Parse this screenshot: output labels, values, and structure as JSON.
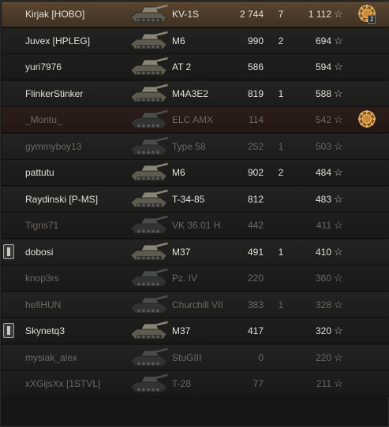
{
  "rows": [
    {
      "name": "Kirjak [HOBO]",
      "vehicle": "KV-1S",
      "damage": "2 744",
      "kills": "7",
      "xp": "1 112",
      "alive": true,
      "me": true,
      "platoon": false,
      "medal": true,
      "medal_count": "2"
    },
    {
      "name": "Juvex [HPLEG]",
      "vehicle": "M6",
      "damage": "990",
      "kills": "2",
      "xp": "694",
      "alive": true,
      "platoon": false,
      "medal": false
    },
    {
      "name": "yuri7976",
      "vehicle": "AT 2",
      "damage": "586",
      "kills": "",
      "xp": "594",
      "alive": true,
      "platoon": false,
      "medal": false
    },
    {
      "name": "FlinkerStinker",
      "vehicle": "M4A3E2",
      "damage": "819",
      "kills": "1",
      "xp": "588",
      "alive": true,
      "platoon": false,
      "medal": false
    },
    {
      "name": "_Montu_",
      "vehicle": "ELC AMX",
      "damage": "114",
      "kills": "",
      "xp": "542",
      "alive": false,
      "red": true,
      "platoon": false,
      "medal": true,
      "medal_count": ""
    },
    {
      "name": "gymmyboy13",
      "vehicle": "Type 58",
      "damage": "252",
      "kills": "1",
      "xp": "503",
      "alive": false,
      "platoon": false,
      "medal": false
    },
    {
      "name": "pattutu",
      "vehicle": "M6",
      "damage": "902",
      "kills": "2",
      "xp": "484",
      "alive": true,
      "platoon": false,
      "medal": false
    },
    {
      "name": "Raydinski [P-MS]",
      "vehicle": "T-34-85",
      "damage": "812",
      "kills": "",
      "xp": "483",
      "alive": true,
      "platoon": false,
      "medal": false
    },
    {
      "name": "Tigris71",
      "vehicle": "VK 36.01 H",
      "damage": "442",
      "kills": "",
      "xp": "411",
      "alive": false,
      "platoon": false,
      "medal": false
    },
    {
      "name": "dobosi",
      "vehicle": "M37",
      "damage": "491",
      "kills": "1",
      "xp": "410",
      "alive": true,
      "platoon": true,
      "medal": false
    },
    {
      "name": "knop3rs",
      "vehicle": "Pz. IV",
      "damage": "220",
      "kills": "",
      "xp": "360",
      "alive": false,
      "platoon": false,
      "medal": false
    },
    {
      "name": "hefiHUN",
      "vehicle": "Churchill VII",
      "damage": "383",
      "kills": "1",
      "xp": "328",
      "alive": false,
      "platoon": false,
      "medal": false
    },
    {
      "name": "Skynetq3",
      "vehicle": "M37",
      "damage": "417",
      "kills": "",
      "xp": "320",
      "alive": true,
      "platoon": true,
      "medal": false
    },
    {
      "name": "mysiak_alex",
      "vehicle": "StuGIII",
      "damage": "0",
      "kills": "",
      "xp": "220",
      "alive": false,
      "platoon": false,
      "medal": false
    },
    {
      "name": "xXGijsXx [1STVL]",
      "vehicle": "T-28",
      "damage": "77",
      "kills": "",
      "xp": "211",
      "alive": false,
      "platoon": false,
      "medal": false
    }
  ],
  "icons": {
    "star": "star-icon",
    "tank": "tank-icon",
    "medal": "medal-icon",
    "platoon": "platoon-icon"
  }
}
